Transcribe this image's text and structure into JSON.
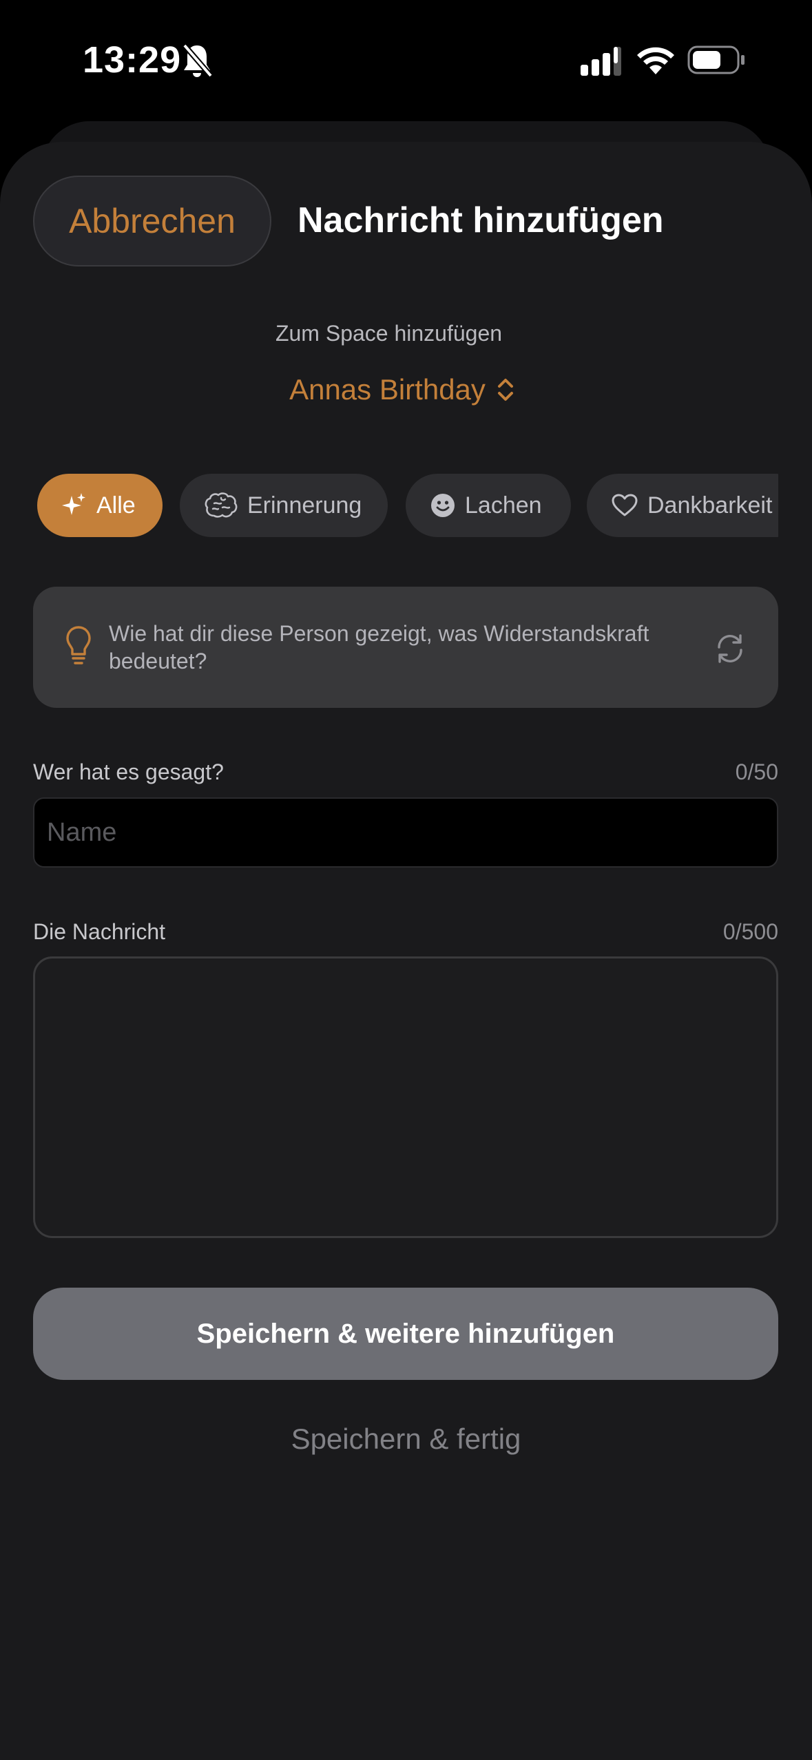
{
  "status_bar": {
    "time": "13:29",
    "icons": [
      "bell-slash-icon",
      "signal-icon",
      "wifi-icon",
      "battery-icon"
    ]
  },
  "header": {
    "cancel_label": "Abbrechen",
    "title": "Nachricht hinzufügen"
  },
  "space": {
    "label": "Zum Space hinzufügen",
    "selected": "Annas Birthday"
  },
  "categories": [
    {
      "label": "Alle",
      "icon": "sparkles-icon",
      "active": true
    },
    {
      "label": "Erinnerung",
      "icon": "brain-icon",
      "active": false
    },
    {
      "label": "Lachen",
      "icon": "smiley-icon",
      "active": false
    },
    {
      "label": "Dankbarkeit",
      "icon": "heart-icon",
      "active": false
    }
  ],
  "prompt": {
    "text": "Wie hat dir diese Person gezeigt, was Widerstandskraft bedeutet?",
    "icon": "lightbulb-icon",
    "refresh_icon": "refresh-icon"
  },
  "name_field": {
    "label": "Wer hat es gesagt?",
    "count": "0/50",
    "placeholder": "Name",
    "value": ""
  },
  "message_field": {
    "label": "Die Nachricht",
    "count": "0/500",
    "value": ""
  },
  "actions": {
    "save_more": "Speichern & weitere hinzufügen",
    "save_done": "Speichern & fertig"
  },
  "colors": {
    "accent": "#c4803a",
    "background": "#1a1a1c",
    "button_disabled": "#6d6e74"
  }
}
